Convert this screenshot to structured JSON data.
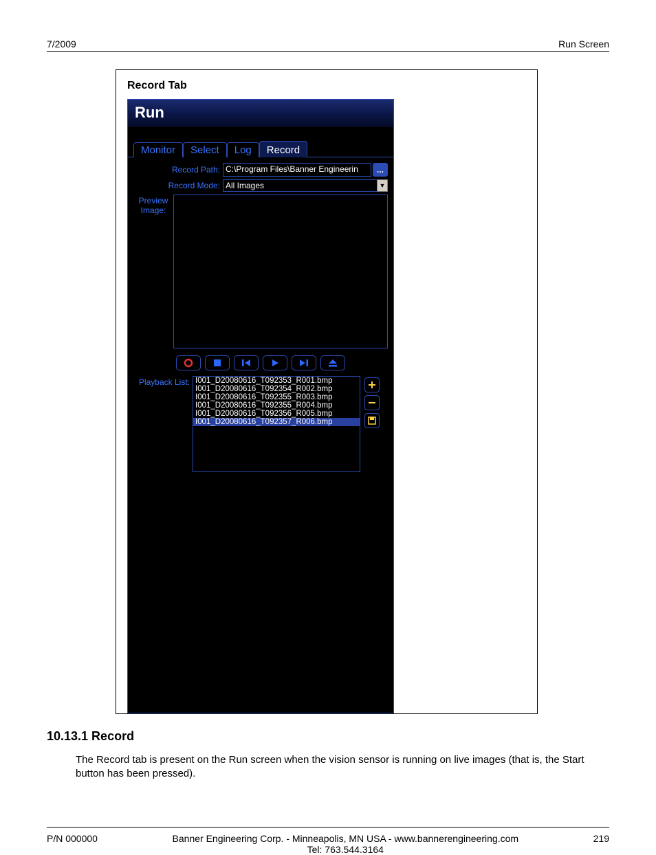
{
  "header": {
    "left": "7/2009",
    "right": "Run Screen"
  },
  "figure": {
    "caption": "Record Tab",
    "app_title": "Run",
    "tabs": [
      "Monitor",
      "Select",
      "Log",
      "Record"
    ],
    "active_tab_index": 3,
    "record_path_label": "Record Path:",
    "record_path_value": "C:\\Program Files\\Banner Engineerin",
    "browse_glyph": "...",
    "record_mode_label": "Record Mode:",
    "record_mode_value": "All Images",
    "preview_label_line1": "Preview",
    "preview_label_line2": "Image:",
    "playback_label": "Playback List:",
    "playback_items": [
      "I001_D20080616_T092353_R001.bmp",
      "I001_D20080616_T092354_R002.bmp",
      "I001_D20080616_T092355_R003.bmp",
      "I001_D20080616_T092355_R004.bmp",
      "I001_D20080616_T092356_R005.bmp",
      "I001_D20080616_T092357_R006.bmp"
    ],
    "playback_selected_index": 5
  },
  "section": {
    "heading": "10.13.1 Record",
    "body": "The Record tab is present on the Run screen when the vision sensor is running on live images (that is, the Start button has been pressed)."
  },
  "footer": {
    "left": "P/N 000000",
    "center_line1": "Banner Engineering Corp. - Minneapolis, MN USA - www.bannerengineering.com",
    "center_line2": "Tel: 763.544.3164",
    "right": "219"
  }
}
